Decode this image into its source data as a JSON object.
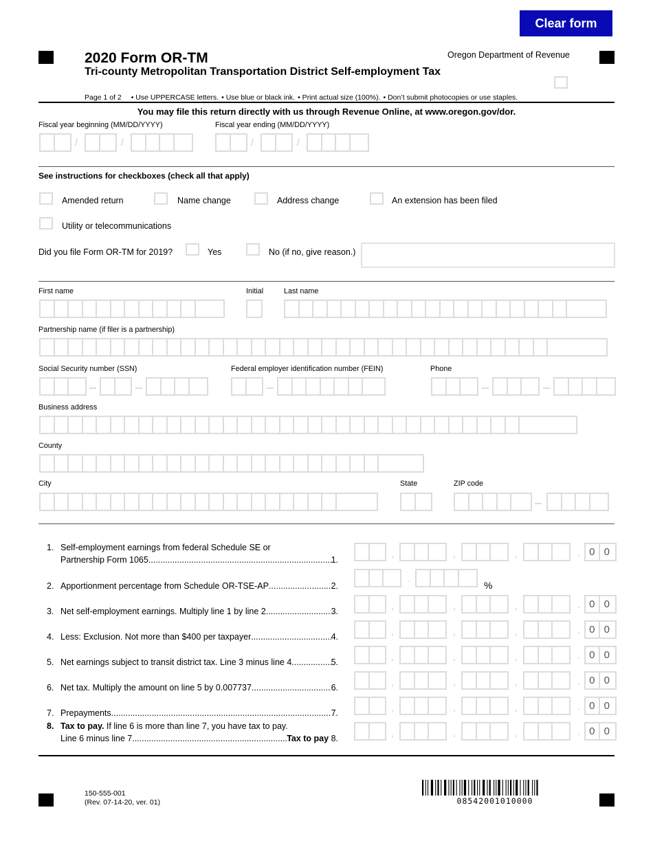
{
  "header": {
    "clear_button": "Clear form",
    "title": "2020 Form OR-TM",
    "subtitle": "Tri-county Metropolitan Transportation District Self-employment Tax",
    "department": "Oregon Department of Revenue",
    "page": "Page 1 of 2",
    "instructions": [
      "• Use UPPERCASE letters.",
      "• Use blue or black ink.",
      "• Print actual size (100%).",
      "• Don’t submit photocopies or use staples."
    ],
    "online_notice": "You may file this return directly with us through Revenue Online, at www.oregon.gov/dor."
  },
  "fiscal": {
    "beginning_label": "Fiscal year beginning (MM/DD/YYYY)",
    "ending_label": "Fiscal year ending (MM/DD/YYYY)",
    "separator": "/"
  },
  "checkboxes": {
    "heading": "See instructions for checkboxes (check all that apply)",
    "amended": "Amended return",
    "name_change": "Name change",
    "address_change": "Address change",
    "extension": "An extension has been filed",
    "utility": "Utility or telecommunications",
    "filed_question": "Did you file Form OR-TM for 2019?",
    "yes": "Yes",
    "no": "No (if no, give reason.)"
  },
  "identity": {
    "first_name": "First name",
    "initial": "Initial",
    "last_name": "Last name",
    "partnership": "Partnership name (if filer is a partnership)",
    "ssn": "Social Security number (SSN)",
    "fein": "Federal employer identification number (FEIN)",
    "phone": "Phone",
    "address": "Business address",
    "county": "County",
    "city": "City",
    "state": "State",
    "zip": "ZIP code"
  },
  "lines": [
    {
      "num": "1.",
      "text1": "Self-employment earnings from federal Schedule SE or",
      "text2": "Partnership Form 1065",
      "ref": "1.",
      "cents": [
        "0",
        "0"
      ]
    },
    {
      "num": "2.",
      "text": "Apportionment percentage from Schedule OR-TSE-AP",
      "ref": "2.",
      "suffix": "%"
    },
    {
      "num": "3.",
      "text": "Net self-employment earnings. Multiply line 1 by line 2",
      "ref": "3.",
      "cents": [
        "0",
        "0"
      ]
    },
    {
      "num": "4.",
      "text": "Less: Exclusion. Not more than $400 per taxpayer",
      "ref": "4.",
      "cents": [
        "0",
        "0"
      ]
    },
    {
      "num": "5.",
      "text": "Net earnings subject to transit district tax. Line 3 minus line 4",
      "ref": "5.",
      "cents": [
        "0",
        "0"
      ]
    },
    {
      "num": "6.",
      "text": "Net tax. Multiply the amount on line 5 by 0.007737",
      "ref": "6.",
      "cents": [
        "0",
        "0"
      ]
    },
    {
      "num": "7.",
      "text": "Prepayments",
      "ref": "7.",
      "cents": [
        "0",
        "0"
      ]
    },
    {
      "num": "8.",
      "bold1": "Tax to pay.",
      "text1": " If line 6 is more than line 7, you have tax to pay.",
      "text2": "Line 6 minus line 7",
      "ref_bold": "Tax to pay",
      "ref": " 8.",
      "cents": [
        "0",
        "0"
      ]
    }
  ],
  "footer": {
    "form_number": "150-555-001",
    "revision": "(Rev. 07-14-20, ver. 01)",
    "barcode_number": "08542001010000"
  }
}
